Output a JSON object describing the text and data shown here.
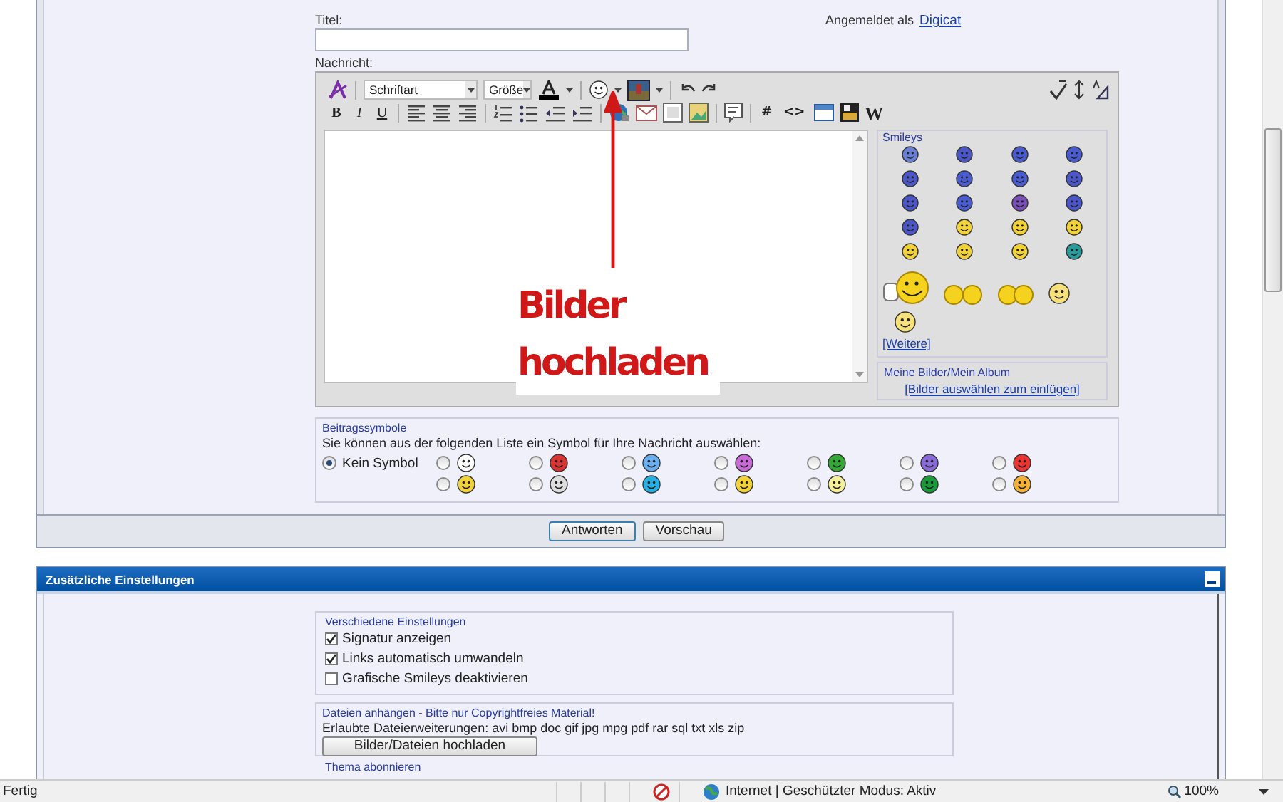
{
  "form": {
    "title_label": "Titel:",
    "login_text": "Angemeldet als",
    "login_user": "Digicat",
    "message_label": "Nachricht:"
  },
  "editor": {
    "font_select": "Schriftart",
    "size_select": "Größe",
    "format_buttons": [
      "B",
      "I",
      "U"
    ],
    "code_buttons": [
      "#",
      "<>"
    ],
    "word_button": "W"
  },
  "smileys": {
    "title": "Smileys",
    "more_link": "[Weitere]"
  },
  "album": {
    "title": "Meine Bilder/Mein Album",
    "link": "[Bilder auswählen zum einfügen]"
  },
  "annotation": {
    "text": "Bilder hochladen"
  },
  "post_icons": {
    "legend": "Beitragssymbole",
    "hint": "Sie können aus der folgenden Liste ein Symbol für Ihre Nachricht auswählen:",
    "options": [
      {
        "kind": "text",
        "label": "Kein Symbol",
        "selected": true
      },
      {
        "kind": "icon",
        "selected": false
      },
      {
        "kind": "icon",
        "selected": false
      },
      {
        "kind": "icon",
        "selected": false
      },
      {
        "kind": "icon",
        "selected": false
      },
      {
        "kind": "icon",
        "selected": false
      },
      {
        "kind": "icon",
        "selected": false
      },
      {
        "kind": "icon",
        "selected": false
      },
      {
        "kind": "icon",
        "selected": false
      },
      {
        "kind": "icon",
        "selected": false
      },
      {
        "kind": "icon",
        "selected": false
      },
      {
        "kind": "icon",
        "selected": false
      },
      {
        "kind": "icon",
        "selected": false
      },
      {
        "kind": "icon",
        "selected": false
      },
      {
        "kind": "icon",
        "selected": false
      }
    ]
  },
  "buttons": [
    "Antworten",
    "Vorschau"
  ],
  "settings_panel": {
    "title": "Zusätzliche Einstellungen",
    "options_legend": "Verschiedene Einstellungen",
    "options": [
      {
        "label": "Signatur anzeigen",
        "checked": true
      },
      {
        "label": "Links automatisch umwandeln",
        "checked": true
      },
      {
        "label": "Grafische Smileys deaktivieren",
        "checked": false
      }
    ],
    "attach_legend": "Dateien anhängen - Bitte nur Copyrightfreies Material!",
    "attach_text": "Erlaubte Dateierweiterungen: avi bmp doc gif jpg mpg pdf rar sql txt xls zip",
    "attach_button": "Bilder/Dateien hochladen",
    "subscribe_legend": "Thema abonnieren"
  },
  "status_bar": {
    "text": "Fertig",
    "zone": "Internet | Geschützter Modus: Aktiv",
    "zoom": "100%"
  }
}
